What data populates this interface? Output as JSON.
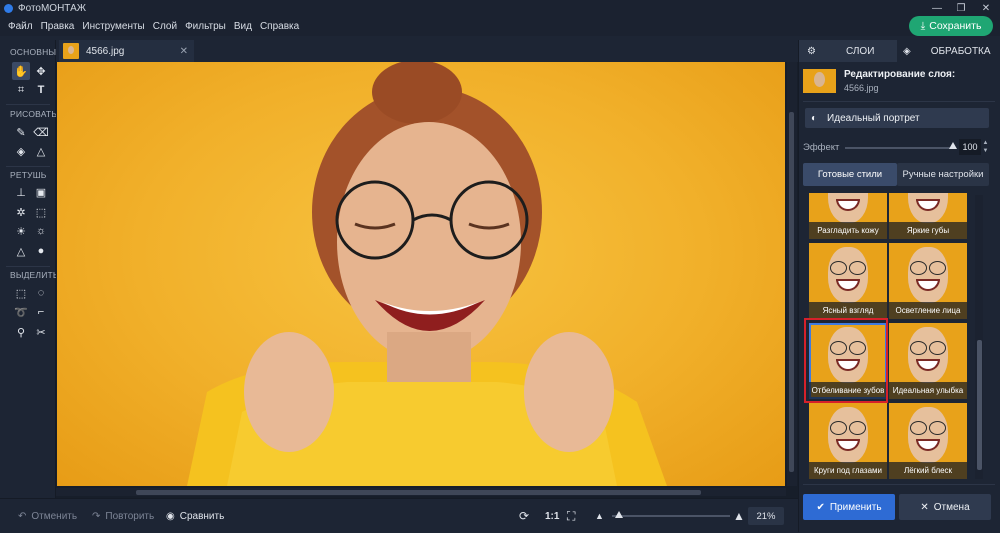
{
  "window": {
    "title": "ФотоМОНТАЖ"
  },
  "menu": [
    "Файл",
    "Правка",
    "Инструменты",
    "Слой",
    "Фильтры",
    "Вид",
    "Справка"
  ],
  "save_label": "Сохранить",
  "toolbox": {
    "sections": [
      "ОСНОВНЫЕ",
      "РИСОВАТЬ",
      "РЕТУШЬ",
      "ВЫДЕЛИТЬ"
    ],
    "tools": [
      "hand-icon",
      "move-icon",
      "crop-icon",
      "text-icon",
      "brush-icon",
      "eraser-icon",
      "fill-icon",
      "shapes-icon",
      "stamp-icon",
      "patch-icon",
      "healing-icon",
      "frame-icon",
      "lighten-icon",
      "darken-icon",
      "sharpen-icon",
      "blur-icon",
      "rect-select-icon",
      "ellipse-select-icon",
      "lasso-icon",
      "polygon-lasso-icon",
      "magic-wand-icon",
      "brush-select-icon"
    ]
  },
  "document_tab": {
    "name": "4566.jpg",
    "close": "✕"
  },
  "bottom": {
    "undo": "Отменить",
    "redo": "Повторить",
    "compare": "Сравнить",
    "ratio": "1:1",
    "zoom": "21%",
    "zoom_value": 0.21
  },
  "panel": {
    "tabs": [
      "СЛОИ",
      "ОБРАБОТКА"
    ],
    "active_tab": "ОБРАБОТКА",
    "layer_title": "Редактирование слоя:",
    "layer_file": "4566.jpg",
    "preset": "Идеальный портрет",
    "effect_label": "Эффект",
    "effect_value": "100",
    "modes": [
      "Готовые стили",
      "Ручные настройки"
    ],
    "styles": [
      {
        "label": "Разгладить кожу"
      },
      {
        "label": "Яркие губы"
      },
      {
        "label": "Ясный взгляд"
      },
      {
        "label": "Осветление лица"
      },
      {
        "label": "Отбеливание зубов"
      },
      {
        "label": "Идеальная улыбка"
      },
      {
        "label": "Круги под глазами"
      },
      {
        "label": "Лёгкий блеск"
      }
    ],
    "selected_style": "Отбеливание зубов",
    "apply": "Применить",
    "cancel": "Отмена"
  },
  "colors": {
    "accent": "#2e6bd4",
    "save": "#1fa673",
    "background": "#f1b02a",
    "highlight": "#d6212a"
  }
}
